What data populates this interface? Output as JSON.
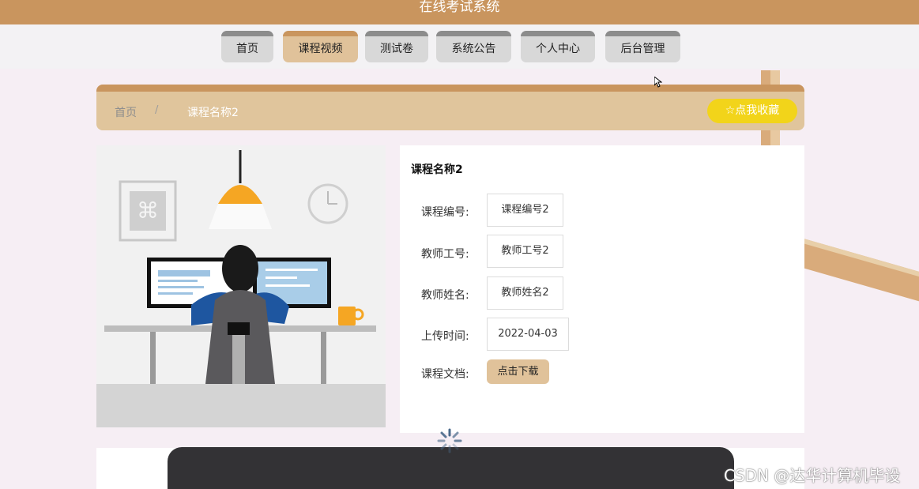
{
  "header": {
    "title": "在线考试系统"
  },
  "nav": {
    "items": [
      {
        "label": "首页"
      },
      {
        "label": "课程视频",
        "active": true
      },
      {
        "label": "测试卷"
      },
      {
        "label": "系统公告"
      },
      {
        "label": "个人中心"
      },
      {
        "label": "后台管理"
      }
    ]
  },
  "breadcrumb": {
    "home": "首页",
    "separator": "/",
    "current": "课程名称2"
  },
  "favorite": {
    "label": "☆点我收藏"
  },
  "course": {
    "title": "课程名称2",
    "fields": [
      {
        "label": "课程编号:",
        "value": "课程编号2"
      },
      {
        "label": "教师工号:",
        "value": "教师工号2"
      },
      {
        "label": "教师姓名:",
        "value": "教师姓名2"
      },
      {
        "label": "上传时间:",
        "value": "2022-04-03"
      }
    ],
    "doc_label": "课程文档:",
    "download_label": "点击下载"
  },
  "watermark": {
    "text": "CSDN @达华计算机毕设"
  },
  "colors": {
    "brand": "#c9955e",
    "nav_active": "#e0c29a",
    "favorite": "#f2d41a",
    "player": "#333235"
  }
}
